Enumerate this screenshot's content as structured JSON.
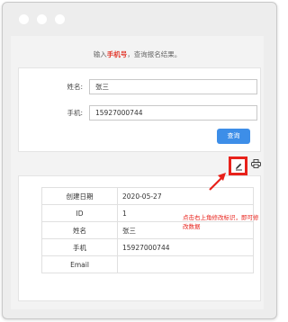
{
  "window": {
    "control_dots": 3
  },
  "hint": {
    "prefix": "输入",
    "highlight": "手机号",
    "suffix": "，查询报名结果。"
  },
  "form": {
    "name_label": "姓名:",
    "name_value": "张三",
    "phone_label": "手机:",
    "phone_value": "15927000744",
    "submit_label": "查询"
  },
  "result": {
    "rows": [
      {
        "key": "创建日期",
        "value": "2020-05-27"
      },
      {
        "key": "ID",
        "value": "1"
      },
      {
        "key": "姓名",
        "value": "张三"
      },
      {
        "key": "手机",
        "value": "15927000744"
      },
      {
        "key": "Email",
        "value": ""
      }
    ]
  },
  "actions": {
    "edit_icon": "pencil-icon",
    "print_icon": "printer-icon"
  },
  "annotation": {
    "text": "点击右上角修改标识，即可修改数据"
  },
  "colors": {
    "highlight": "#e8221b",
    "button": "#3d8ee8"
  }
}
